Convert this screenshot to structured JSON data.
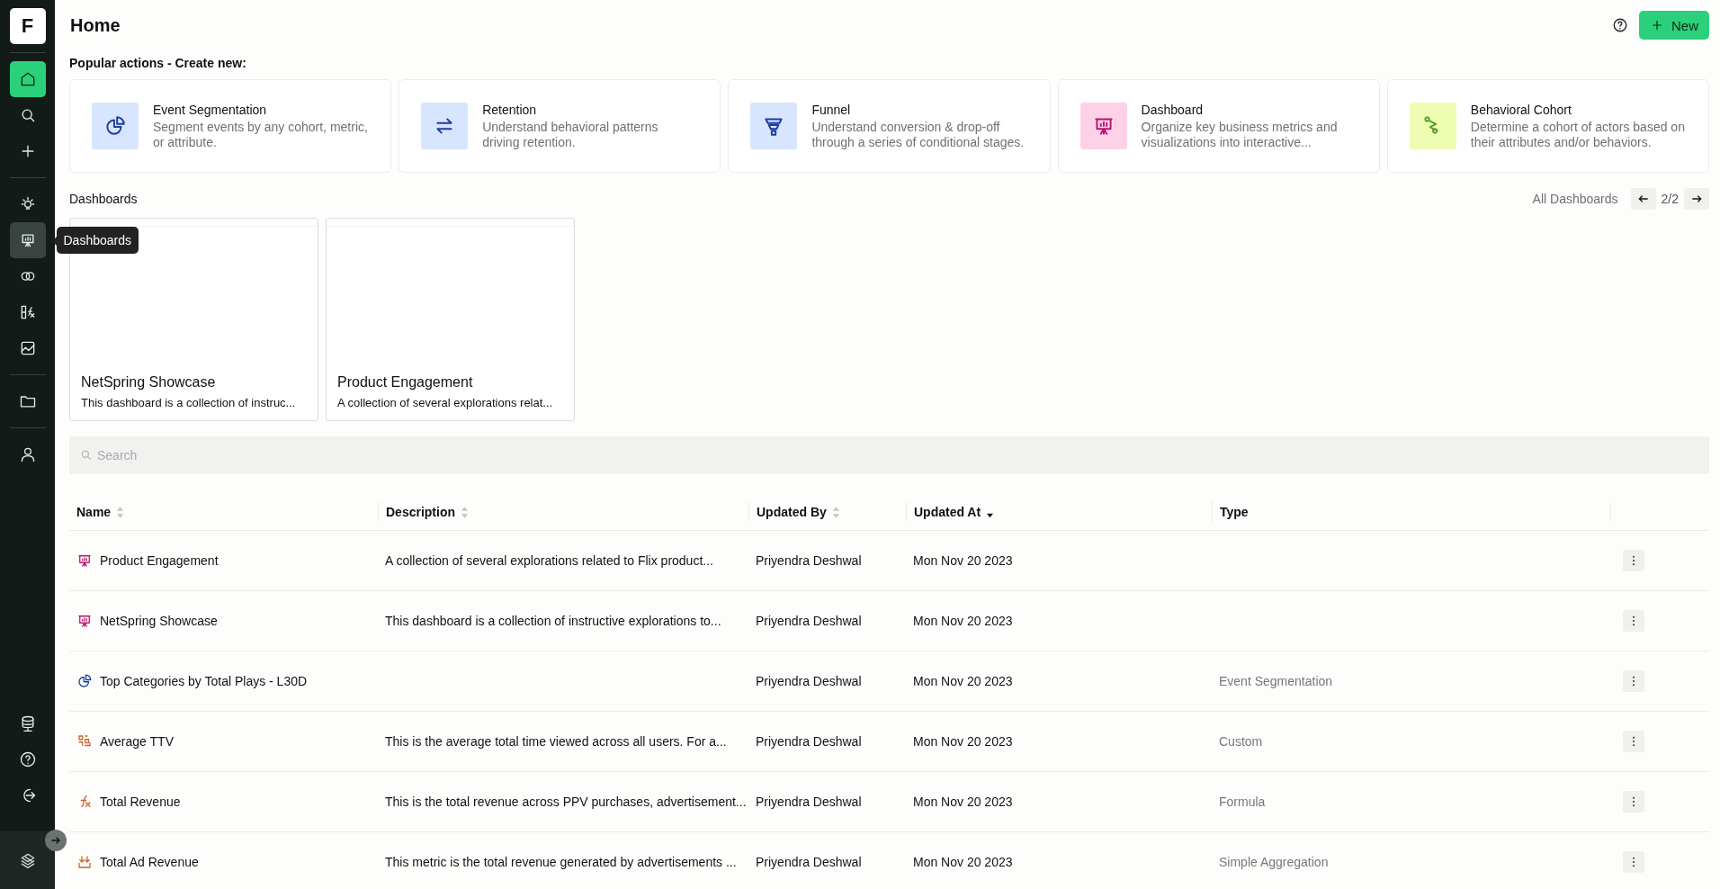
{
  "sidebar": {
    "logo": "F",
    "top_items": [
      {
        "kind": "home",
        "selected": true,
        "hovered": false
      },
      {
        "kind": "search",
        "selected": false,
        "hovered": false
      },
      {
        "kind": "plus",
        "selected": false,
        "hovered": false
      },
      {
        "kind": "divider"
      },
      {
        "kind": "bulb",
        "selected": false,
        "hovered": false
      },
      {
        "kind": "dashboard",
        "selected": false,
        "hovered": true
      },
      {
        "kind": "circles",
        "selected": false,
        "hovered": false
      },
      {
        "kind": "formula",
        "selected": false,
        "hovered": false
      },
      {
        "kind": "chart",
        "selected": false,
        "hovered": false
      },
      {
        "kind": "divider"
      },
      {
        "kind": "folder",
        "selected": false,
        "hovered": false
      },
      {
        "kind": "divider"
      },
      {
        "kind": "person",
        "selected": false,
        "hovered": false
      }
    ],
    "bottom_items": [
      {
        "kind": "database",
        "selected": false,
        "hovered": false
      },
      {
        "kind": "help",
        "selected": false,
        "hovered": false
      },
      {
        "kind": "logout",
        "selected": false,
        "hovered": false
      }
    ],
    "tooltip": "Dashboards"
  },
  "header": {
    "title": "Home",
    "new_button": "New"
  },
  "popular": {
    "heading": "Popular actions - Create new:",
    "cards": [
      {
        "kind": "segmentation",
        "title": "Event Segmentation",
        "description": "Segment events by any cohort, metric, or attribute."
      },
      {
        "kind": "retention",
        "title": "Retention",
        "description": "Understand behavioral patterns driving retention."
      },
      {
        "kind": "funnel",
        "title": "Funnel",
        "description": "Understand conversion & drop-off through a series of conditional stages."
      },
      {
        "kind": "dashboard",
        "title": "Dashboard",
        "description": "Organize key business metrics and visualizations into interactive..."
      },
      {
        "kind": "cohort",
        "title": "Behavioral Cohort",
        "description": "Determine a cohort of actors based on their attributes and/or behaviors."
      }
    ]
  },
  "dashboards": {
    "heading": "Dashboards",
    "all_link": "All Dashboards",
    "page": "2/2",
    "cards": [
      {
        "title": "NetSpring Showcase",
        "description": "This dashboard is a collection of instruc..."
      },
      {
        "title": "Product Engagement",
        "description": "A collection of several explorations relat..."
      }
    ]
  },
  "search": {
    "placeholder": "Search"
  },
  "table": {
    "columns": [
      {
        "label": "Name",
        "sortable": true,
        "descending": false
      },
      {
        "label": "Description",
        "sortable": true,
        "descending": false
      },
      {
        "label": "Updated By",
        "sortable": true,
        "descending": false
      },
      {
        "label": "Updated At",
        "sortable": true,
        "descending": true
      },
      {
        "label": "Type",
        "sortable": false
      }
    ],
    "rows": [
      {
        "kind": "dashboard",
        "name": "Product Engagement",
        "description": "A collection of several explorations related to Flix product...",
        "updated_by": "Priyendra Deshwal",
        "updated_at": "Mon Nov 20 2023"
      },
      {
        "kind": "dashboard",
        "name": "NetSpring Showcase",
        "description": "This dashboard is a collection of instructive explorations to...",
        "updated_by": "Priyendra Deshwal",
        "updated_at": "Mon Nov 20 2023"
      },
      {
        "kind": "segmentation",
        "name": "Top Categories by Total Plays - L30D",
        "updated_by": "Priyendra Deshwal",
        "updated_at": "Mon Nov 20 2023",
        "type": "Event Segmentation"
      },
      {
        "kind": "custom",
        "name": "Average TTV",
        "description": "This is the average total time viewed across all users. For a...",
        "updated_by": "Priyendra Deshwal",
        "updated_at": "Mon Nov 20 2023",
        "type": "Custom"
      },
      {
        "kind": "formula",
        "name": "Total Revenue",
        "description": "This is the total revenue across PPV purchases, advertisement...",
        "updated_by": "Priyendra Deshwal",
        "updated_at": "Mon Nov 20 2023",
        "type": "Formula"
      },
      {
        "kind": "aggregation",
        "name": "Total Ad Revenue",
        "description": "This metric is the total revenue generated by advertisements ...",
        "updated_by": "Priyendra Deshwal",
        "updated_at": "Mon Nov 20 2023",
        "type": "Simple Aggregation"
      }
    ]
  }
}
